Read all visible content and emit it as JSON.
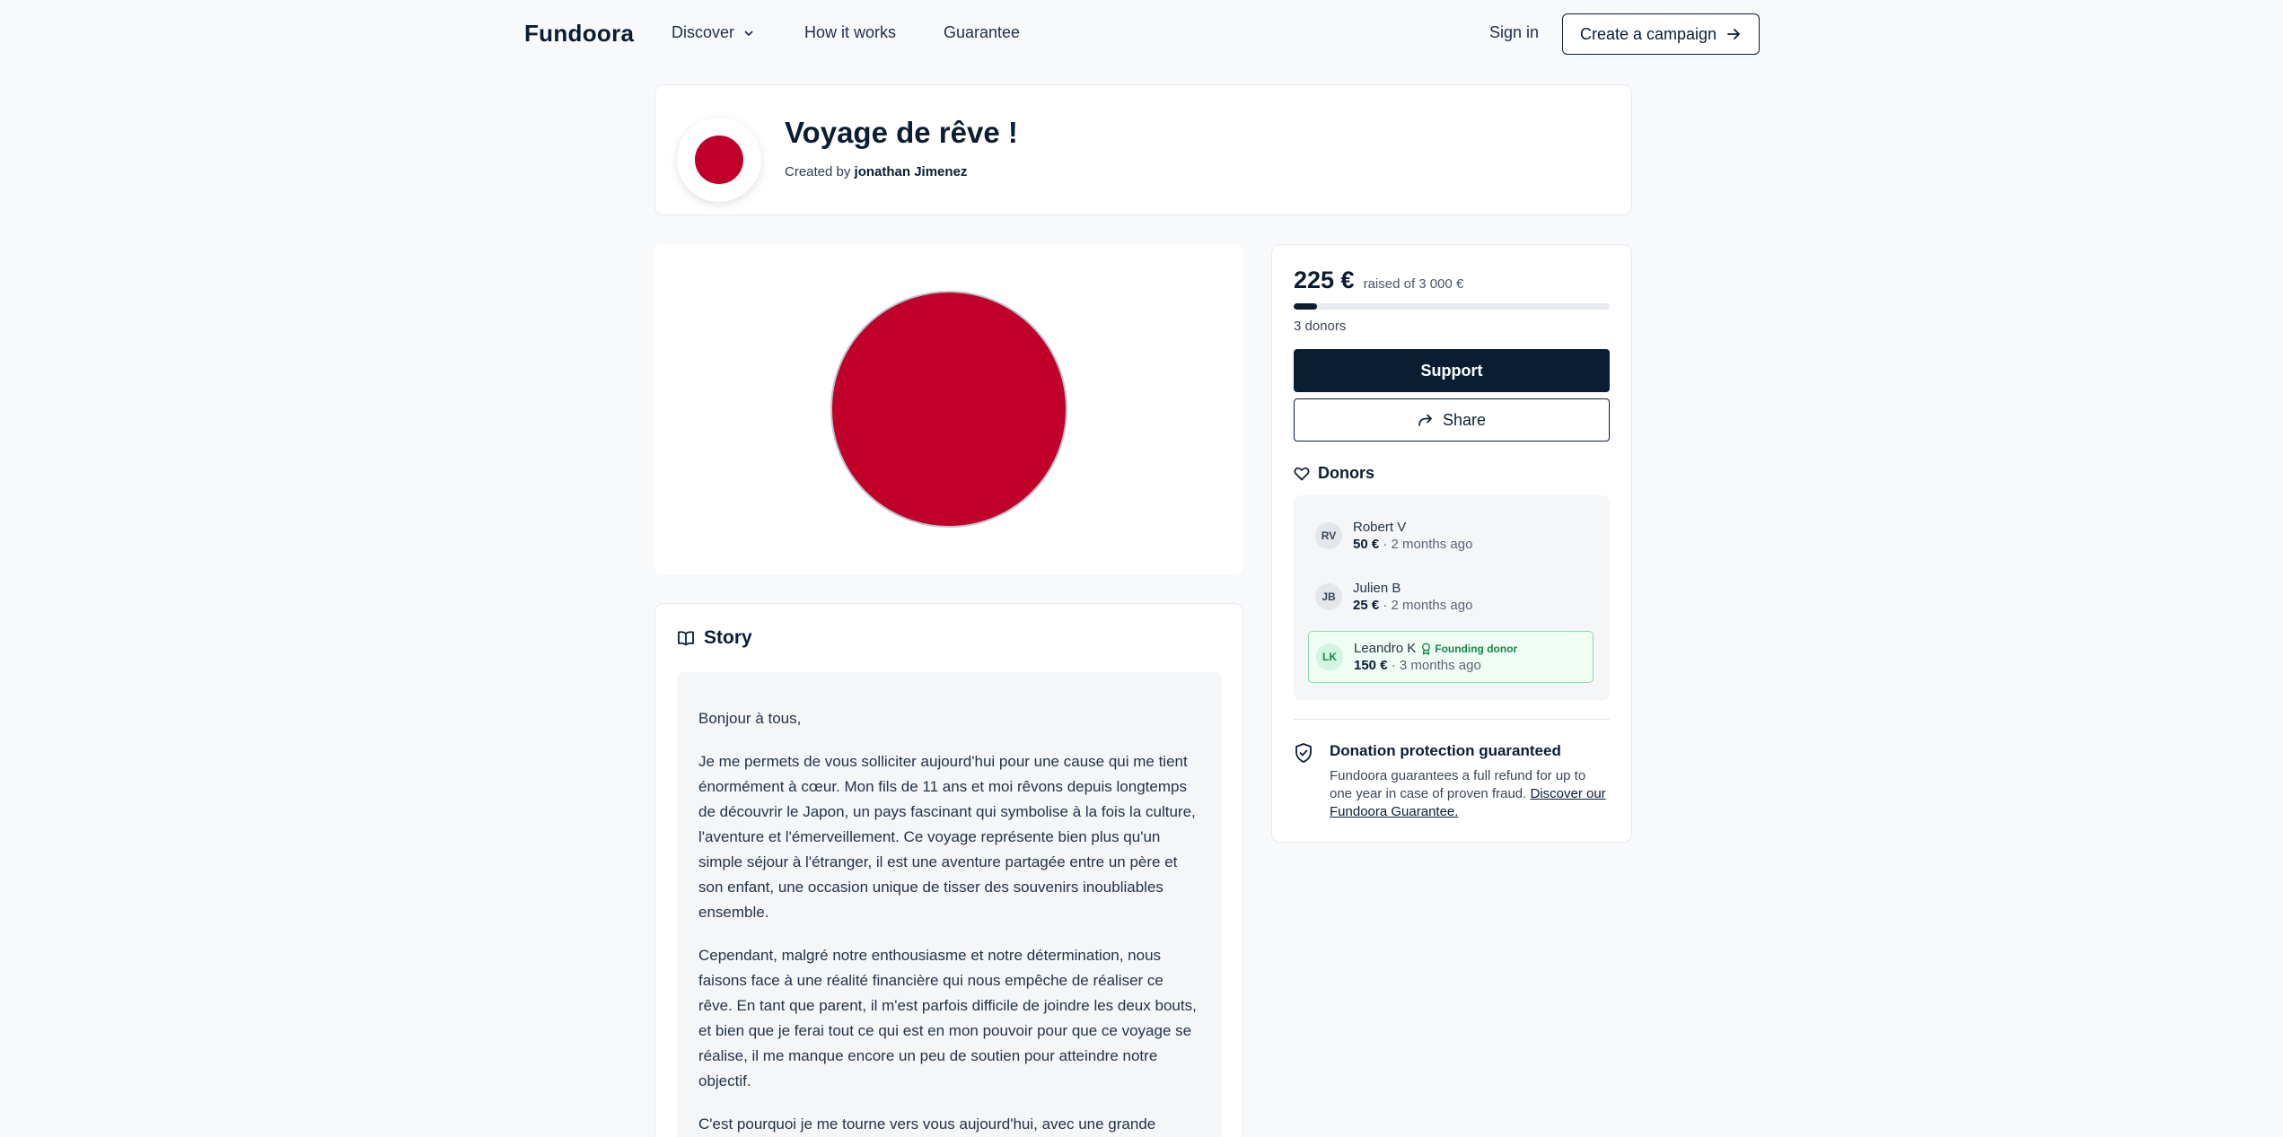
{
  "nav": {
    "logo": "Fundoora",
    "discover": "Discover",
    "how_it_works": "How it works",
    "guarantee": "Guarantee",
    "sign_in": "Sign in",
    "create_campaign": "Create a campaign"
  },
  "campaign": {
    "title": "Voyage de rêve !",
    "created_by_label": "Created by",
    "creator": "jonathan Jimenez"
  },
  "funding": {
    "raised": "225 €",
    "raised_of": "raised of 3 000 €",
    "progress_fraction": 0.075,
    "donors_count": "3 donors",
    "support_label": "Support",
    "share_label": "Share"
  },
  "donors": {
    "heading": "Donors",
    "items": [
      {
        "initials": "RV",
        "name": "Robert V",
        "amount": "50 €",
        "sep": "·",
        "time": "2 months ago",
        "badge": ""
      },
      {
        "initials": "JB",
        "name": "Julien B",
        "amount": "25 €",
        "sep": "·",
        "time": "2 months ago",
        "badge": ""
      },
      {
        "initials": "LK",
        "name": "Leandro K",
        "amount": "150 €",
        "sep": "·",
        "time": "3 months ago",
        "badge": "Founding donor"
      }
    ]
  },
  "protection": {
    "title": "Donation protection guaranteed",
    "text": "Fundoora guarantees a full refund for up to one year in case of proven fraud.",
    "link": "Discover our Fundoora Guarantee."
  },
  "story": {
    "heading": "Story",
    "paragraphs": [
      "Bonjour à tous,",
      "Je me permets de vous solliciter aujourd'hui pour une cause qui me tient énormément à cœur. Mon fils de 11 ans et moi rêvons depuis longtemps de découvrir le Japon, un pays fascinant qui symbolise à la fois la culture, l'aventure et l'émerveillement. Ce voyage représente bien plus qu'un simple séjour à l'étranger, il est une aventure partagée entre un père et son enfant, une occasion unique de tisser des souvenirs inoubliables ensemble.",
      "Cependant, malgré notre enthousiasme et notre détermination, nous faisons face à une réalité financière qui nous empêche de réaliser ce rêve. En tant que parent, il m'est parfois difficile de joindre les deux bouts, et bien que je ferai tout ce qui est en mon pouvoir pour que ce voyage se réalise, il me manque encore un peu de soutien pour atteindre notre objectif.",
      "C'est pourquoi je me tourne vers vous aujourd'hui, avec une grande"
    ]
  },
  "colors": {
    "brand_navy": "#0b1d33",
    "flag_red": "#c10029",
    "founding_green": "#16884a"
  }
}
